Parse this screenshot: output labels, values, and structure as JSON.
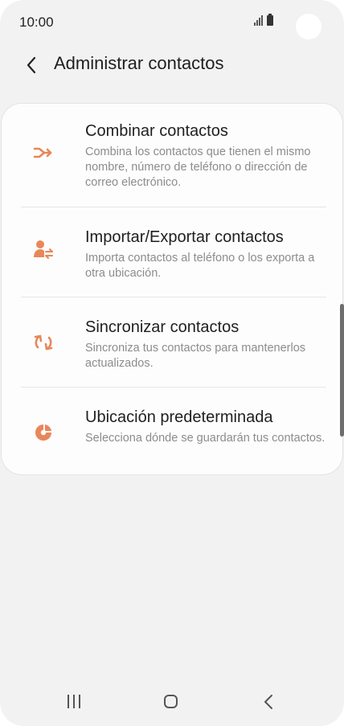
{
  "status_bar": {
    "time": "10:00"
  },
  "header": {
    "title": "Administrar contactos"
  },
  "items": [
    {
      "title": "Combinar contactos",
      "description": "Combina los contactos que tienen el mismo nombre, número de teléfono o dirección de correo electrónico.",
      "icon": "merge-icon"
    },
    {
      "title": "Importar/Exportar contactos",
      "description": "Importa contactos al teléfono o los exporta a otra ubicación.",
      "icon": "import-export-icon"
    },
    {
      "title": "Sincronizar contactos",
      "description": "Sincroniza tus contactos para mantenerlos actualizados.",
      "icon": "sync-icon"
    },
    {
      "title": "Ubicación predeterminada",
      "description": "Selecciona dónde se guardarán tus contactos.",
      "icon": "storage-location-icon"
    }
  ],
  "colors": {
    "accent": "#e8875a",
    "background": "#f2f2f2",
    "card": "#fdfdfd",
    "title_text": "#1f1f1f",
    "secondary_text": "#8c8c8c"
  }
}
